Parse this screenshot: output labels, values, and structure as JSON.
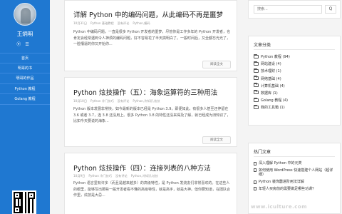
{
  "sidebar": {
    "site_name": "王炳明",
    "nav": [
      "首页",
      "明哥的书",
      "明哥的作品",
      "Python 教程",
      "Golang 教程"
    ]
  },
  "posts": [
    {
      "title": "详解 Python 中的编码问题，从此编码不再是噩梦",
      "date": "10月31日",
      "category": "Python 基础教程",
      "comments": "没有评论",
      "tags": "Python,编码",
      "excerpt": "Python 中编码问题，一直是很多 Python 开发者的噩梦，尽管你是工作多年的 Python 开发者，也肯定会经常遇到令人神烦的编码问题，好不容易花了半天搞明白了。一般时间后，又全都忘光光了，一脸懵逼的你又开始你...",
      "read_more": "阅读全文"
    },
    {
      "title": "Python 炫技操作（五）：海象运算符的三种用法",
      "date": "10月10日",
      "category": "Python 冷门技巧",
      "comments": "没有评论",
      "tags": "Python,冷知识,炫技",
      "excerpt": "Python 版本发展非常快，如今最新的版本已经是 Python 3.9，即便如此，有很多人甚至还停留在 3.6 或者 3.7，连 3.8 还没用上。很多 Python 3.8 的特性还没来得及了解，就已经成为旧知识了，比如今天要说的海象...",
      "read_more": "阅读全文"
    },
    {
      "title": "Python 炫技操作（四）：连接列表的八种方法",
      "date": "10月9日",
      "category": "Python 冷门技巧",
      "comments": "没有评论",
      "tags": "Python,冷知识,炫技",
      "excerpt": "Python 语言里有许多（而且是越来越多）的高级特性，是 Python 发烧友们非常喜欢的。在这些人的眼里，能够写出那些一般开发者看不懂的高级特性，就是高手，就是大神。但你要知道，在团队合作里，炫技是大忌..."
    }
  ],
  "search": {
    "placeholder": "搜索...",
    "button": "Q"
  },
  "categories": {
    "title": "文章分类",
    "items": [
      "Python 教程 (94)",
      "网站建设 (4)",
      "技术理财 (1)",
      "网络基础 (4)",
      "计算机基础 (4)",
      "数据库 (1)",
      "Golang 教程 (4)",
      "我的工具箱 (1)"
    ]
  },
  "hot": {
    "title": "热门文章",
    "items": [
      "深入理解 Python 中的元类",
      "如何使用 WordPress 快速搭建个人网站（超详细）",
      "Python 装饰器进阶用法详解",
      "年轻人买房前的需要做足哪些功课？"
    ]
  },
  "watermark": "www.iculture.com"
}
